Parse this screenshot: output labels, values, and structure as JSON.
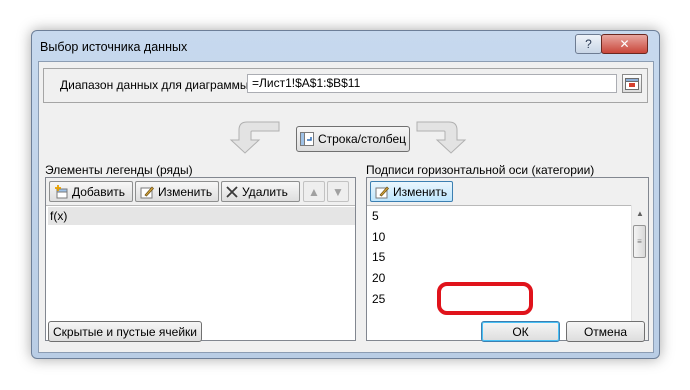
{
  "dialog": {
    "title": "Выбор источника данных",
    "help_label": "?",
    "close_label": "✕"
  },
  "range": {
    "label": "Диапазон данных для диаграммы:",
    "value": "=Лист1!$A$1:$B$11"
  },
  "switch_button": {
    "label": "Строка/столбец"
  },
  "legend": {
    "heading": "Элементы легенды (ряды)",
    "add_label": "Добавить",
    "edit_label": "Изменить",
    "delete_label": "Удалить",
    "items": [
      "f(x)"
    ]
  },
  "axis": {
    "heading": "Подписи горизонтальной оси (категории)",
    "edit_label": "Изменить",
    "items": [
      "5",
      "10",
      "15",
      "20",
      "25"
    ]
  },
  "footer": {
    "hidden_cells_label": "Скрытые и пустые ячейки",
    "ok_label": "ОК",
    "cancel_label": "Отмена"
  },
  "colors": {
    "highlight": "#e0131b",
    "selected_row": "#e5e5e5"
  }
}
